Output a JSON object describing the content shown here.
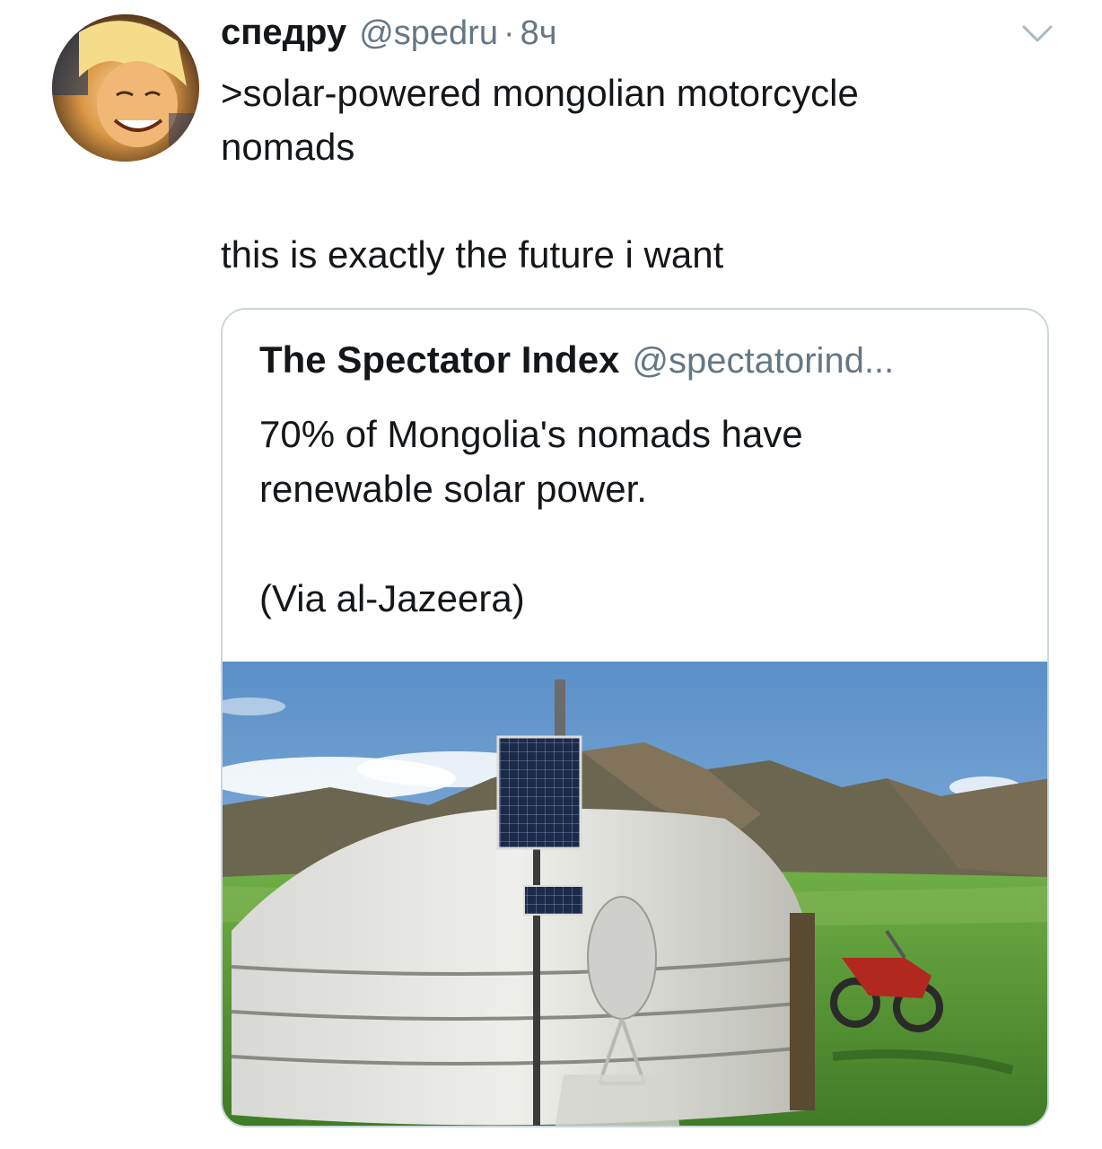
{
  "tweet": {
    "display_name": "спедру",
    "handle": "@spedru",
    "separator": "·",
    "time": "8ч",
    "text": ">solar-powered mongolian motorcycle\nnomads\n\nthis is exactly the future i want",
    "avatar_icon": "avatar-image",
    "menu_icon": "chevron-down-icon"
  },
  "quote": {
    "display_name": "The Spectator Index",
    "handle": "@spectatorind...",
    "text": "70% of Mongolia's nomads have\nrenewable solar power.\n\n(Via al-Jazeera)"
  },
  "colors": {
    "text_primary": "#14171a",
    "text_secondary": "#657786",
    "card_border": "#ccd6dd"
  }
}
